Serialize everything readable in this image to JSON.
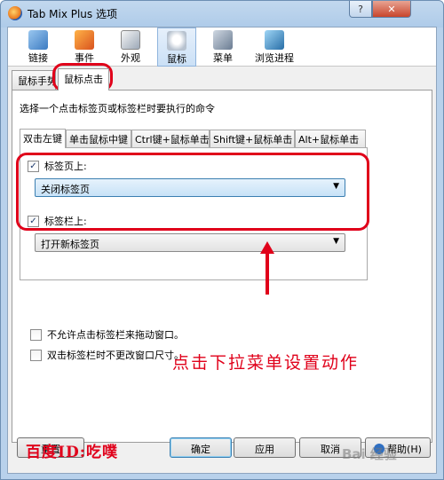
{
  "window": {
    "title": "Tab Mix Plus 选项",
    "help_glyph": "?",
    "close_glyph": "✕"
  },
  "toolbar": {
    "items": [
      {
        "label": "链接",
        "icon": "links-icon"
      },
      {
        "label": "事件",
        "icon": "events-icon"
      },
      {
        "label": "外观",
        "icon": "appearance-icon"
      },
      {
        "label": "鼠标",
        "icon": "mouse-icon",
        "active": true
      },
      {
        "label": "菜单",
        "icon": "menu-icon"
      },
      {
        "label": "浏览进程",
        "icon": "session-icon"
      }
    ]
  },
  "outer_tabs": {
    "tab1": "鼠标手势",
    "tab2": "鼠标点击"
  },
  "instruction": "选择一个点击标签页或标签栏时要执行的命令",
  "inner_tabs": {
    "t1": "双击左键",
    "t2": "单击鼠标中键",
    "t3": "Ctrl键+鼠标单击",
    "t4": "Shift键+鼠标单击",
    "t5": "Alt+鼠标单击"
  },
  "on_tab": {
    "label": "标签页上:",
    "checked": true,
    "selected": "关闭标签页"
  },
  "on_tabbar": {
    "label": "标签栏上:",
    "checked": true,
    "selected": "打开新标签页"
  },
  "annotation": "点击下拉菜单设置动作",
  "options": {
    "no_drag": "不允许点击标签栏来拖动窗口。",
    "no_resize": "双击标签栏时不更改窗口尺寸。"
  },
  "watermark": "百度ID:吃噗",
  "baidu_mark": "Bai 经验",
  "buttons": {
    "reset": "重置",
    "ok": "确定",
    "apply": "应用",
    "cancel": "取消",
    "help": "帮助(H)"
  },
  "colors": {
    "annotation_red": "#e0001a",
    "accent_blue": "#3c7fb1"
  }
}
